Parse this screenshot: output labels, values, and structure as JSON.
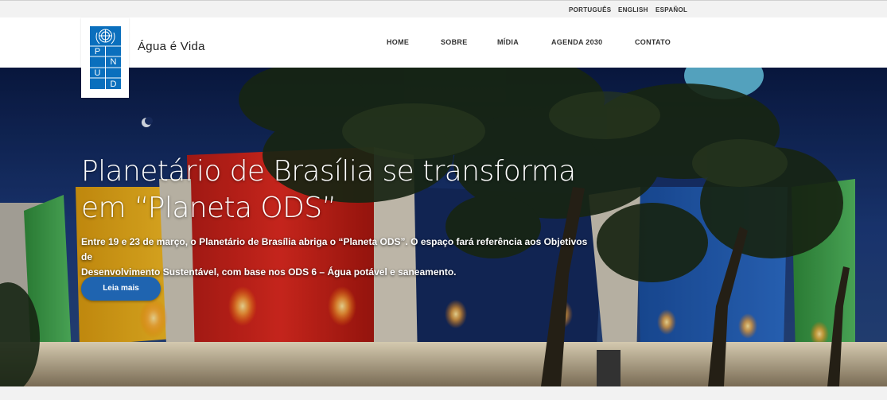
{
  "top_bar": {
    "languages": [
      "PORTUGUÊS",
      "ENGLISH",
      "ESPAÑOL"
    ]
  },
  "header": {
    "logo_letters": [
      "P",
      "N",
      "U",
      "D"
    ],
    "site_title": "Água é Vida",
    "nav": [
      "HOME",
      "SOBRE",
      "MÍDIA",
      "AGENDA 2030",
      "CONTATO"
    ]
  },
  "hero": {
    "headline_line1": "Planetário de Brasília se transforma",
    "headline_line2": "em “Planeta ODS”",
    "summary_line1": "Entre 19 e 23 de março, o Planetário de Brasília abriga o “Planeta ODS”. O espaço fará referência aos Objetivos de",
    "summary_line2": "Desenvolvimento Sustentável, com base nos ODS 6 – Água potável e saneamento.",
    "button_label": "Leia mais"
  },
  "colors": {
    "brand_blue": "#0a6fbd",
    "button_blue": "#1f64b0",
    "panel_red": "#d9271e",
    "panel_yellow": "#f2b21a",
    "panel_navy": "#142a5e",
    "panel_blue": "#1d5fb4",
    "panel_green": "#3fa34d"
  }
}
